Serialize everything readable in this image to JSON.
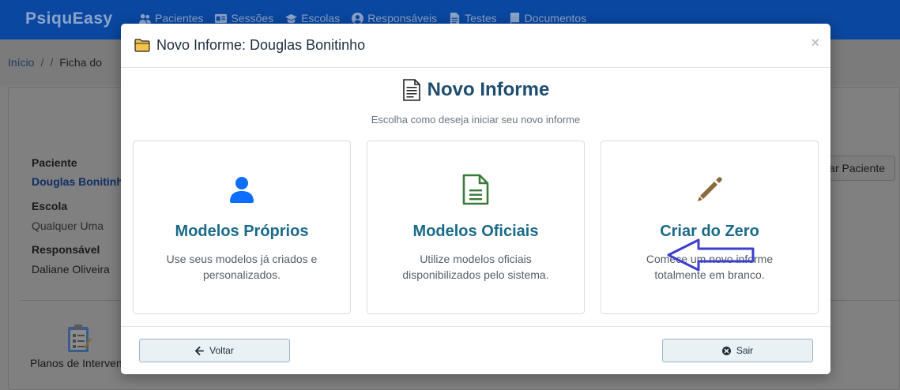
{
  "app": {
    "brand": "PsiquEasy",
    "nav": [
      {
        "label": "Pacientes",
        "icon": "users-icon"
      },
      {
        "label": "Sessões",
        "icon": "id-card-icon"
      },
      {
        "label": "Escolas",
        "icon": "graduation-cap-icon"
      },
      {
        "label": "Responsáveis",
        "icon": "user-circle-icon"
      },
      {
        "label": "Testes",
        "icon": "file-text-icon"
      },
      {
        "label": "Documentos",
        "icon": "book-icon"
      }
    ]
  },
  "breadcrumb": {
    "home": "Início",
    "separator": "/",
    "current": "Ficha do"
  },
  "patient": {
    "patient_label": "Paciente",
    "patient_value": "Douglas Bonitinho",
    "school_label": "Escola",
    "school_value": "Qualquer Uma",
    "guardian_label": "Responsável",
    "guardian_value": "Daliane Oliveira",
    "edit_button": "ar Paciente",
    "plans_label": "Planos de Interven"
  },
  "modal": {
    "title": "Novo Informe: Douglas Bonitinho",
    "title_icon": "folder-icon",
    "close": "×",
    "heading": "Novo Informe",
    "heading_icon": "document-icon",
    "subtitle": "Escolha como deseja iniciar seu novo informe",
    "options": [
      {
        "title": "Modelos Próprios",
        "description": "Use seus modelos já criados e personalizados.",
        "icon": "user-icon",
        "color": "#0d6efd"
      },
      {
        "title": "Modelos Oficiais",
        "description": "Utilize modelos oficiais disponibilizados pelo sistema.",
        "icon": "file-lines-icon",
        "color": "#3b7a3b"
      },
      {
        "title": "Criar do Zero",
        "description": "Comece um novo informe totalmente em branco.",
        "icon": "pencil-icon",
        "color": "#8b6a3e"
      }
    ],
    "back_button": "Voltar",
    "exit_button": "Sair"
  },
  "colors": {
    "navbar": "#0a47a0",
    "title_accent": "#1a6a8a",
    "annotation_arrow": "#3b3fcf"
  }
}
